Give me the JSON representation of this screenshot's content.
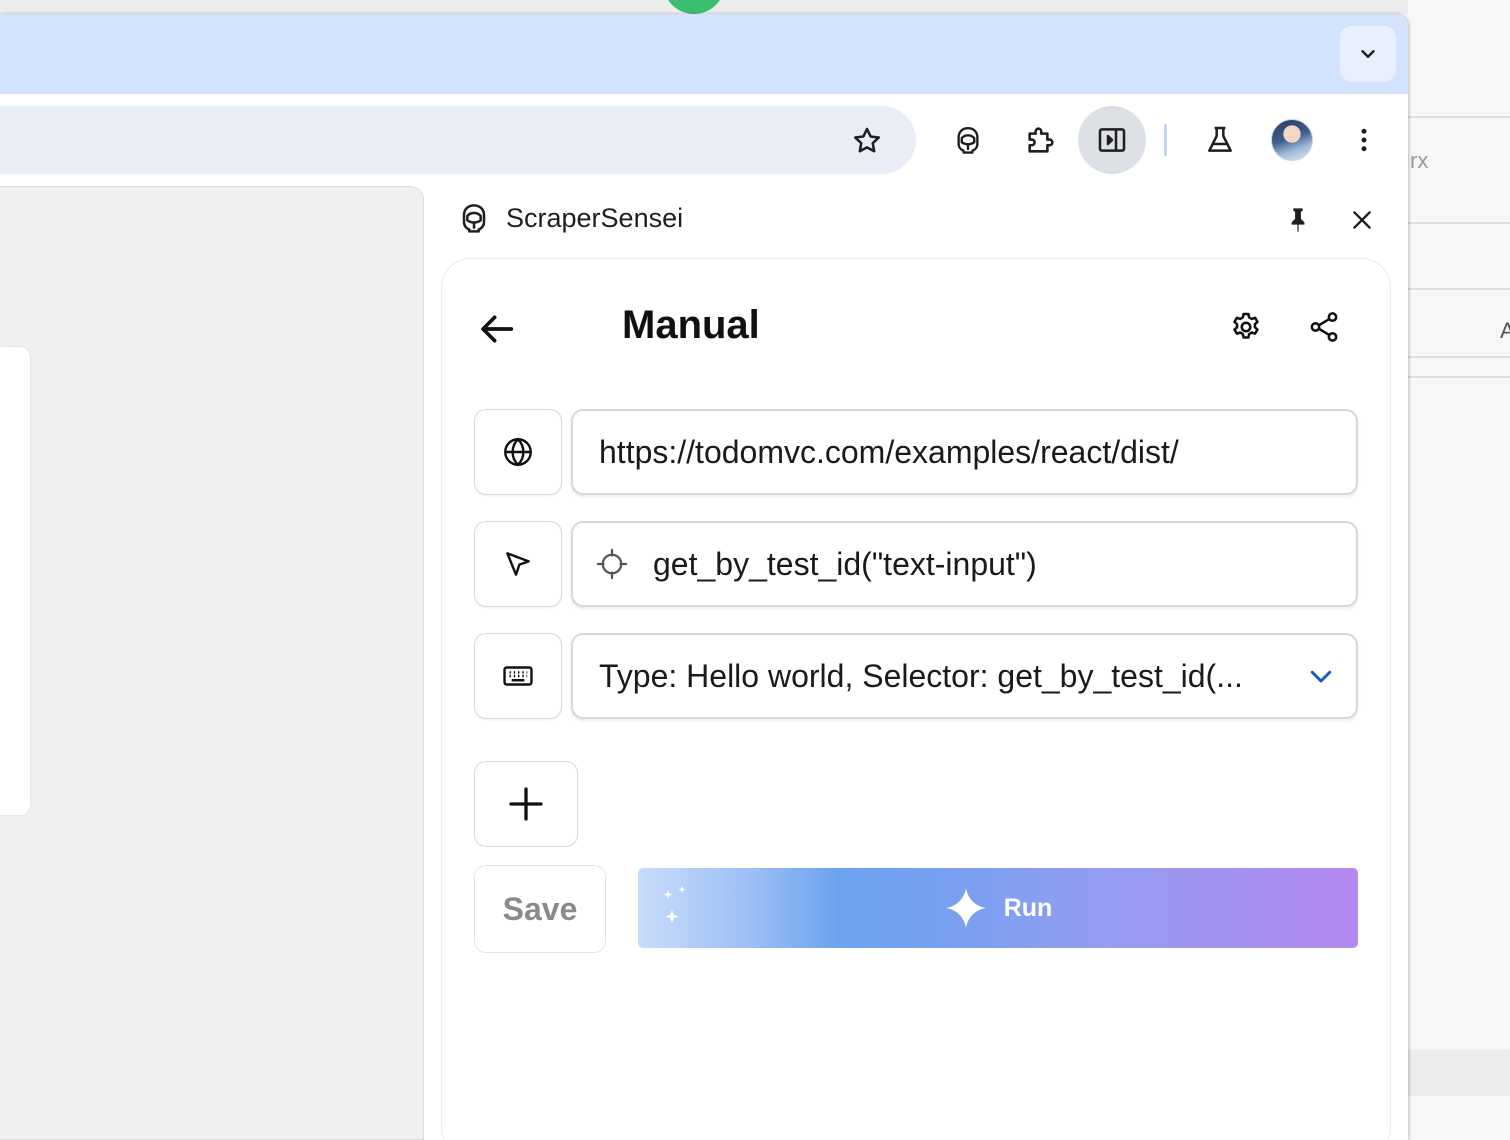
{
  "background": {
    "right_text": "rx",
    "right_text2": "A"
  },
  "browser": {
    "toolbar": {
      "icons": [
        "star-icon",
        "scrapersensei-icon",
        "puzzle-icon",
        "side-panel-icon",
        "flask-icon",
        "avatar",
        "more-vert-icon"
      ]
    }
  },
  "side_panel": {
    "extension_name": "ScraperSensei",
    "title": "Manual",
    "url_value": "https://todomvc.com/examples/react/dist/",
    "selector_value": "get_by_test_id(\"text-input\")",
    "action_summary": "Type: Hello world, Selector: get_by_test_id(...",
    "save_label": "Save",
    "run_label": "Run"
  },
  "colors": {
    "tabstrip": "#d3e3fd",
    "omnibox": "#e9eef6",
    "run_gradient_start": "#c9dcfb",
    "run_gradient_end": "#b589f2",
    "chevron": "#1a56c8"
  }
}
